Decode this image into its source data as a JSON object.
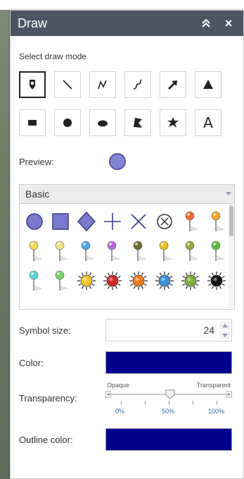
{
  "panel": {
    "title": "Draw",
    "collapse_icon": "double-chevron-up-icon",
    "close_icon": "close-icon",
    "close_label": "×"
  },
  "draw_mode": {
    "label": "Select draw mode",
    "modes": [
      {
        "name": "point-mode-icon",
        "selected": true
      },
      {
        "name": "line-mode-icon"
      },
      {
        "name": "polyline-mode-icon"
      },
      {
        "name": "freehand-polyline-mode-icon"
      },
      {
        "name": "arrow-mode-icon"
      },
      {
        "name": "triangle-mode-icon"
      },
      {
        "name": "rectangle-mode-icon"
      },
      {
        "name": "circle-mode-icon"
      },
      {
        "name": "ellipse-mode-icon"
      },
      {
        "name": "polygon-mode-icon"
      },
      {
        "name": "freehand-polygon-mode-icon"
      },
      {
        "name": "text-mode-icon",
        "text": "A"
      }
    ]
  },
  "preview": {
    "label": "Preview:"
  },
  "symbol_set": {
    "selected": "Basic",
    "caret_icon": "chevron-down-icon"
  },
  "symbols": {
    "shapes": [
      "circle",
      "square",
      "diamond",
      "plus",
      "x",
      "circled-x"
    ],
    "pushpin_colors": [
      "#ee6b32",
      "#f5a623",
      "#f2d74e",
      "#ece28a",
      "#4ea7e8",
      "#b46ad8",
      "#6b6b2c",
      "#e6c228",
      "#9aa43c",
      "#5dbb3b",
      "#5fd5d5",
      "#7ad06b"
    ],
    "sun_colors": [
      "#f4c430",
      "#d22626",
      "#ee7d1f",
      "#3c8fd8",
      "#7db03c",
      "#111111"
    ]
  },
  "symbol_size": {
    "label": "Symbol size:",
    "value": "24"
  },
  "color": {
    "label": "Color:",
    "value": "#00008a"
  },
  "transparency": {
    "label": "Transparency:",
    "left_caption": "Opaque",
    "right_caption": "Transparent",
    "tick_labels": [
      "0%",
      "50%",
      "100%"
    ],
    "value_percent": 50
  },
  "outline_color": {
    "label": "Outline color:",
    "value": "#00008a"
  }
}
